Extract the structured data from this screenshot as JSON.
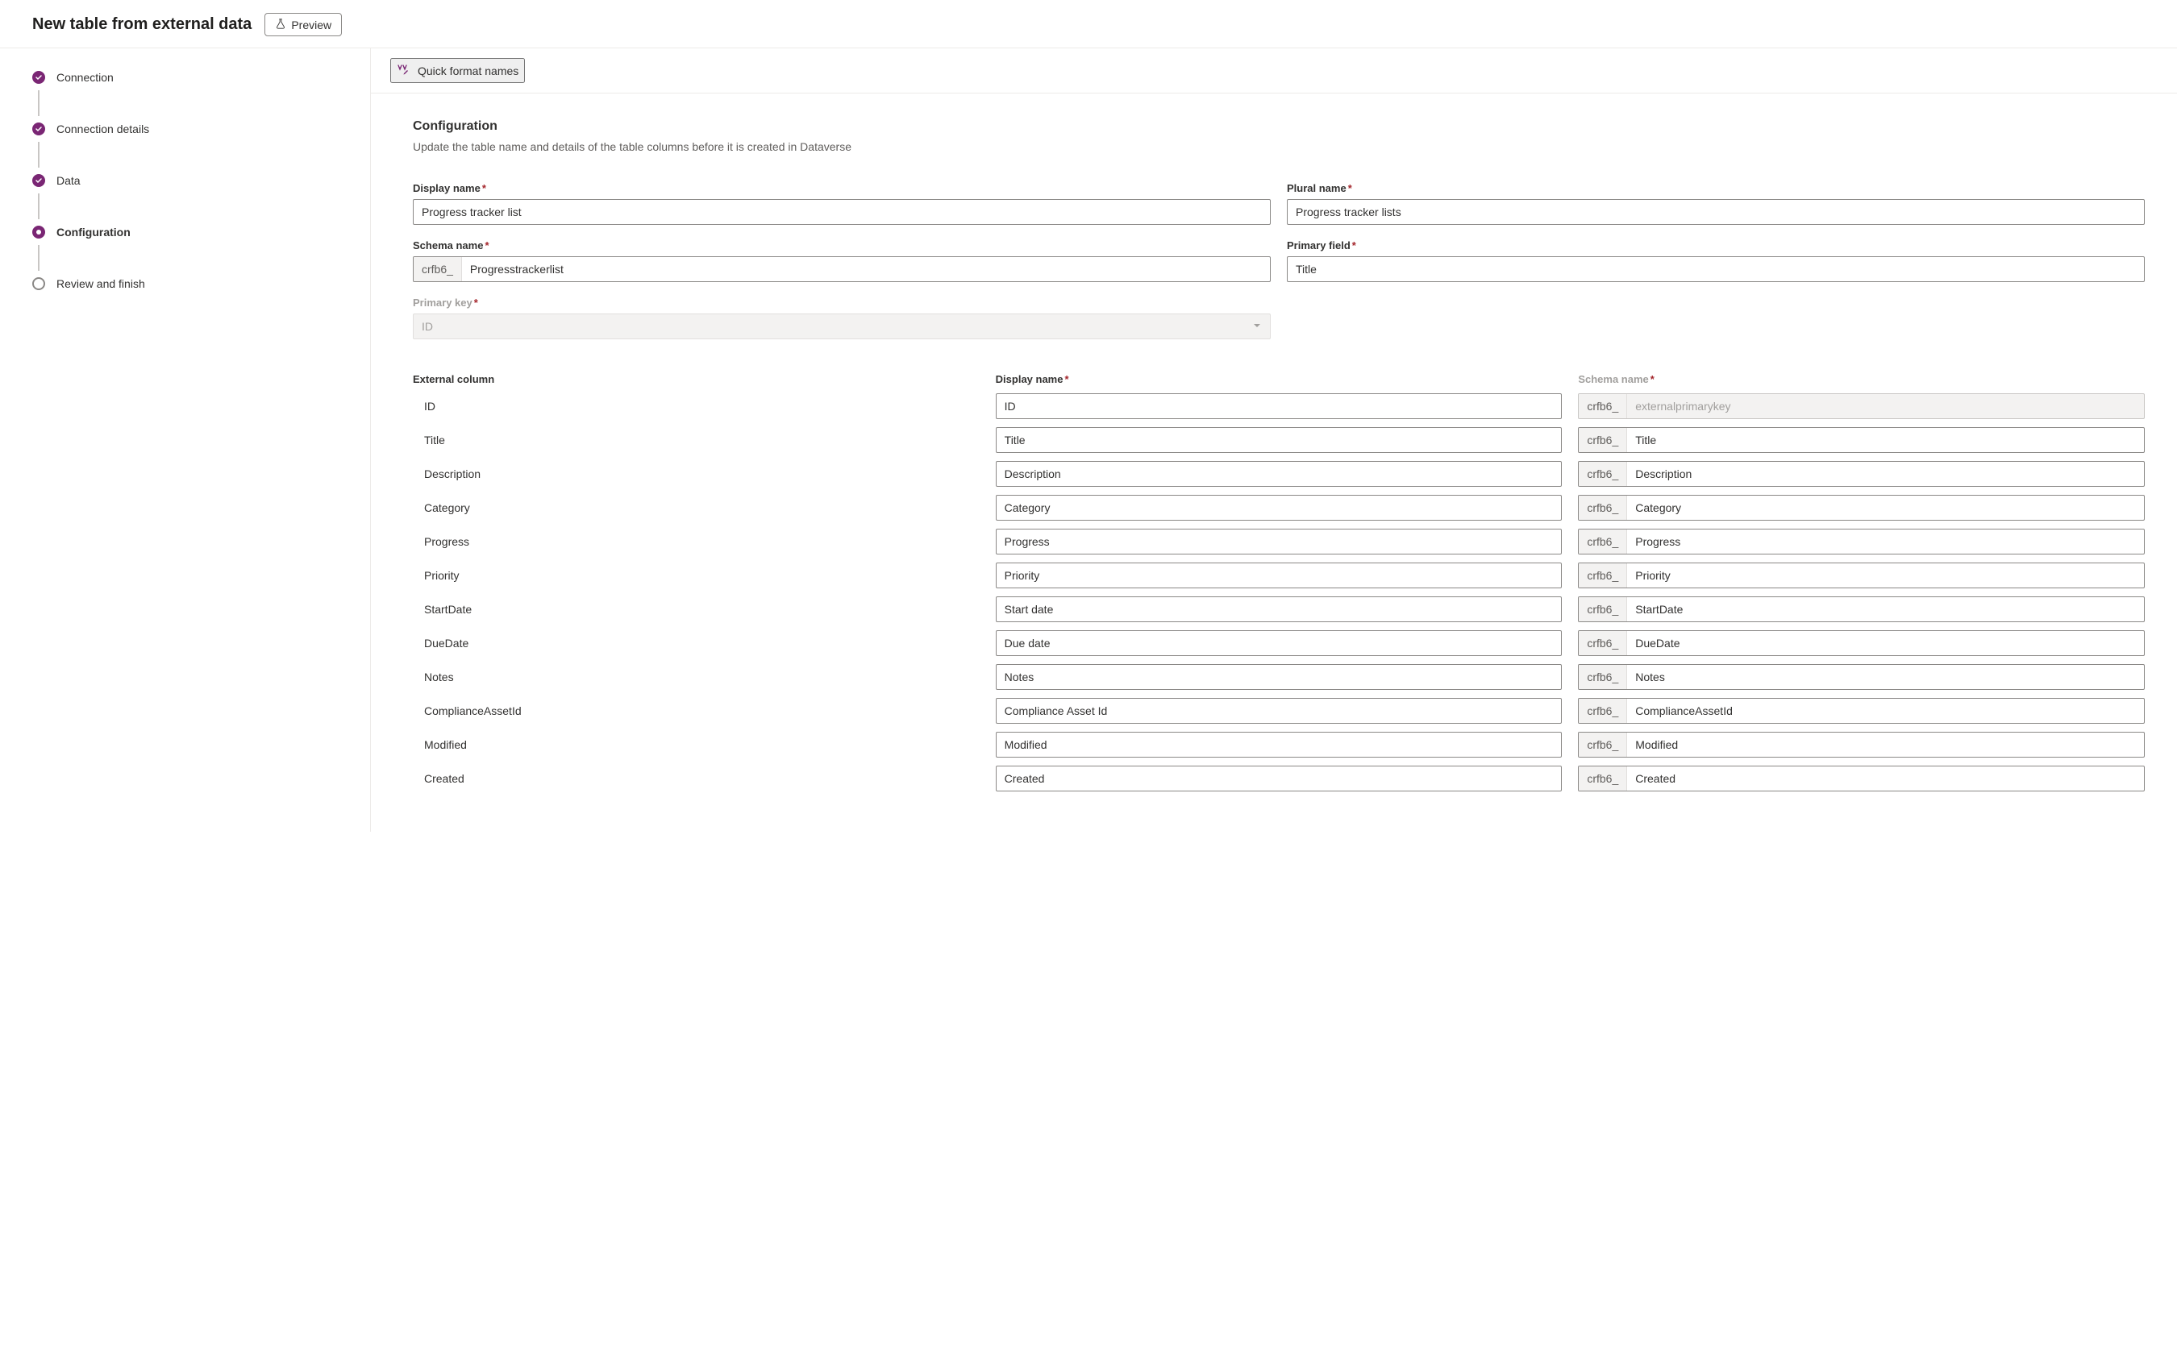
{
  "header": {
    "title": "New table from external data",
    "preview_label": "Preview"
  },
  "steps": [
    {
      "label": "Connection",
      "state": "done"
    },
    {
      "label": "Connection details",
      "state": "done"
    },
    {
      "label": "Data",
      "state": "done"
    },
    {
      "label": "Configuration",
      "state": "current"
    },
    {
      "label": "Review and finish",
      "state": "upcoming"
    }
  ],
  "toolbar": {
    "quick_format_label": "Quick format names"
  },
  "config": {
    "section_title": "Configuration",
    "section_desc": "Update the table name and details of the table columns before it is created in Dataverse",
    "display_name_label": "Display name",
    "display_name_value": "Progress tracker list",
    "plural_name_label": "Plural name",
    "plural_name_value": "Progress tracker lists",
    "schema_name_label": "Schema name",
    "schema_prefix": "crfb6_",
    "schema_name_value": "Progresstrackerlist",
    "primary_field_label": "Primary field",
    "primary_field_value": "Title",
    "primary_key_label": "Primary key",
    "primary_key_value": "ID"
  },
  "columns": {
    "ext_header": "External column",
    "display_header": "Display name",
    "schema_header": "Schema name",
    "schema_prefix": "crfb6_",
    "rows": [
      {
        "ext": "ID",
        "display": "ID",
        "schema": "externalprimarykey",
        "schema_disabled": true
      },
      {
        "ext": "Title",
        "display": "Title",
        "schema": "Title",
        "schema_disabled": false
      },
      {
        "ext": "Description",
        "display": "Description",
        "schema": "Description",
        "schema_disabled": false
      },
      {
        "ext": "Category",
        "display": "Category",
        "schema": "Category",
        "schema_disabled": false
      },
      {
        "ext": "Progress",
        "display": "Progress",
        "schema": "Progress",
        "schema_disabled": false
      },
      {
        "ext": "Priority",
        "display": "Priority",
        "schema": "Priority",
        "schema_disabled": false
      },
      {
        "ext": "StartDate",
        "display": "Start date",
        "schema": "StartDate",
        "schema_disabled": false
      },
      {
        "ext": "DueDate",
        "display": "Due date",
        "schema": "DueDate",
        "schema_disabled": false
      },
      {
        "ext": "Notes",
        "display": "Notes",
        "schema": "Notes",
        "schema_disabled": false
      },
      {
        "ext": "ComplianceAssetId",
        "display": "Compliance Asset Id",
        "schema": "ComplianceAssetId",
        "schema_disabled": false
      },
      {
        "ext": "Modified",
        "display": "Modified",
        "schema": "Modified",
        "schema_disabled": false
      },
      {
        "ext": "Created",
        "display": "Created",
        "schema": "Created",
        "schema_disabled": false
      }
    ]
  }
}
